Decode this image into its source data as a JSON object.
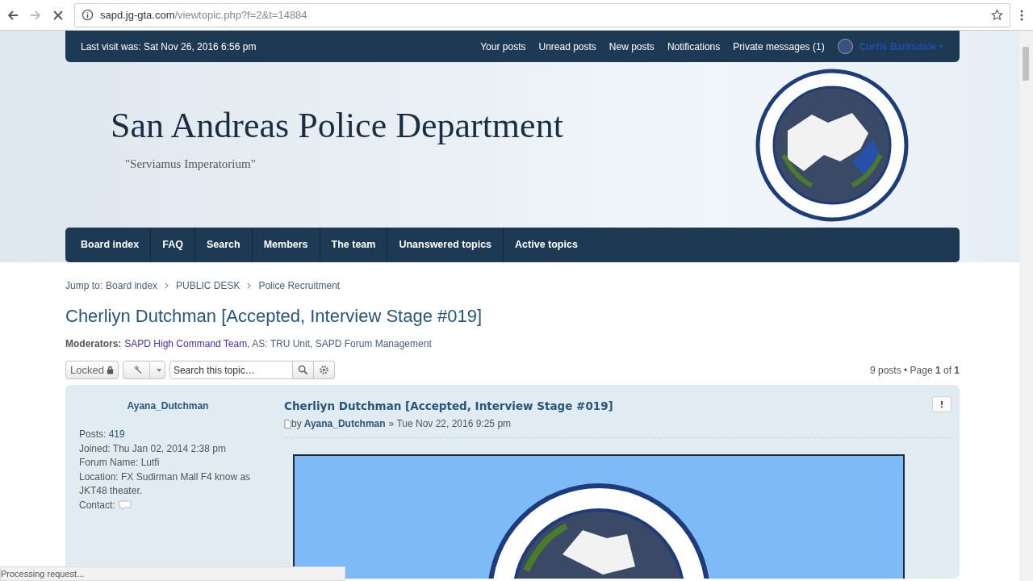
{
  "browser": {
    "url_host": "sapd.jg-gta.com",
    "url_path": "/viewtopic.php?f=2&t=14884",
    "status": "Processing request..."
  },
  "top_bar": {
    "last_visit": "Last visit was: Sat Nov 26, 2016 6:56 pm",
    "links": [
      "Your posts",
      "Unread posts",
      "New posts",
      "Notifications",
      "Private messages (1)"
    ],
    "user": "Curtis Barksdale"
  },
  "header": {
    "title": "San Andreas Police Department",
    "tagline": "\"Serviamus Imperatorium\""
  },
  "navbar": {
    "items": [
      {
        "label": "Board index"
      },
      {
        "label": "FAQ"
      },
      {
        "label": "Search"
      },
      {
        "label": "Members"
      },
      {
        "label": "The team"
      },
      {
        "label": "Unanswered topics"
      },
      {
        "label": "Active topics"
      }
    ]
  },
  "breadcrumbs": {
    "prefix": "Jump to:",
    "items": [
      "Board index",
      "PUBLIC DESK",
      "Police Recruitment"
    ]
  },
  "topic_title": "Cherliyn Dutchman [Accepted, Interview Stage #019]",
  "moderators": {
    "label": "Moderators:",
    "items": [
      {
        "text": "SAPD High Command Team",
        "color": "#4a2fa6"
      },
      {
        "text": ", AS: TRU Unit, SAPD Forum Management",
        "color": "#4c5d77"
      }
    ]
  },
  "toolbar": {
    "locked_label": "Locked",
    "search": {
      "placeholder": "Search this topic…"
    },
    "pagination": "9 posts • Page **1** of **1**"
  },
  "post": {
    "author": "Ayana_Dutchman",
    "profile": [
      {
        "label": "Posts:",
        "value": "419",
        "kind": "link"
      },
      {
        "label": "Joined:",
        "value": "Thu Jan 02, 2014 2:38 pm",
        "kind": "text"
      },
      {
        "label": "Forum Name:",
        "value": "Lutfi",
        "kind": "text"
      },
      {
        "label": "Location:",
        "value": "FX Sudirman Mall F4 know as JKT48 theater.",
        "kind": "text"
      },
      {
        "label": "Contact:",
        "kind": "contact"
      }
    ],
    "title": "Cherliyn Dutchman [Accepted, Interview Stage #019]",
    "by": "by",
    "byline_author": "Ayana_Dutchman",
    "date": "» Tue Nov 22, 2016 9:25 pm",
    "report_label": "!"
  }
}
